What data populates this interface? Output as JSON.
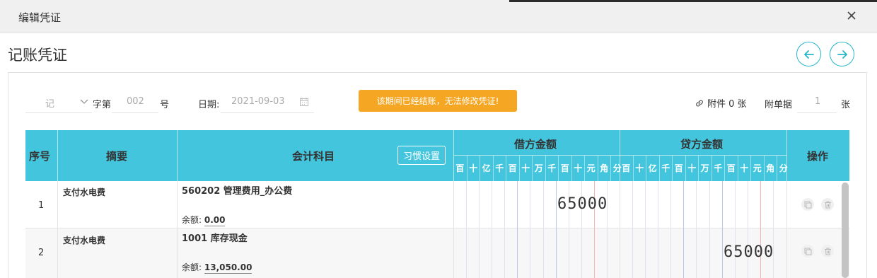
{
  "dialog": {
    "title": "编辑凭证",
    "close_glyph": "×"
  },
  "page": {
    "title": "记账凭证"
  },
  "nav": {
    "prev_icon": "arrow-left-icon",
    "next_icon": "arrow-right-icon"
  },
  "form": {
    "voucher_word": "记",
    "word_label": "字第",
    "number": "002",
    "number_suffix": "号",
    "date_label": "日期:",
    "date_value": "2021-09-03",
    "warning": "该期间已经结账，无法修改凭证!",
    "attachment_label": "附件 0 张",
    "doc_label": "附单据",
    "doc_count": "1",
    "doc_unit": "张"
  },
  "table": {
    "headers": {
      "seq": "序号",
      "summary": "摘要",
      "account": "会计科目",
      "habit_button": "习惯设置",
      "debit": "借方金额",
      "credit": "贷方金额",
      "operation": "操作"
    },
    "digit_units": [
      "百",
      "十",
      "亿",
      "千",
      "百",
      "十",
      "万",
      "千",
      "百",
      "十",
      "元",
      "角",
      "分"
    ],
    "balance_label": "余额:",
    "rows": [
      {
        "seq": "1",
        "summary": "支付水电费",
        "account": "560202 管理费用_办公费",
        "balance": "0.00",
        "debit": "65000",
        "credit": ""
      },
      {
        "seq": "2",
        "summary": "支付水电费",
        "account": "1001 库存现金",
        "balance": "13,050.00",
        "debit": "",
        "credit": "65000"
      }
    ]
  },
  "colors": {
    "header_bg": "#43c6dd",
    "accent": "#23b7cc",
    "warning_bg": "#f5a623"
  }
}
